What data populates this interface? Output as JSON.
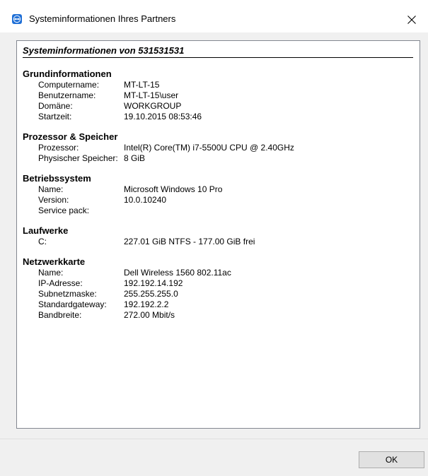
{
  "window": {
    "title": "Systeminformationen Ihres Partners",
    "app_icon": "teamviewer-icon",
    "close_icon": "close-icon"
  },
  "report": {
    "title": "Systeminformationen von 531531531",
    "sections": [
      {
        "heading": "Grundinformationen",
        "rows": [
          {
            "label": "Computername:",
            "value": "MT-LT-15"
          },
          {
            "label": "Benutzername:",
            "value": "MT-LT-15\\user"
          },
          {
            "label": "Domäne:",
            "value": "WORKGROUP"
          },
          {
            "label": "Startzeit:",
            "value": "19.10.2015 08:53:46"
          }
        ]
      },
      {
        "heading": "Prozessor & Speicher",
        "rows": [
          {
            "label": "Prozessor:",
            "value": "Intel(R) Core(TM) i7-5500U CPU @ 2.40GHz"
          },
          {
            "label": "Physischer Speicher:",
            "value": "8 GiB"
          }
        ]
      },
      {
        "heading": "Betriebssystem",
        "rows": [
          {
            "label": "Name:",
            "value": "Microsoft Windows 10 Pro"
          },
          {
            "label": "Version:",
            "value": "10.0.10240"
          },
          {
            "label": "Service pack:",
            "value": ""
          }
        ]
      },
      {
        "heading": "Laufwerke",
        "rows": [
          {
            "label": "C:",
            "value": "227.01 GiB NTFS - 177.00 GiB frei"
          }
        ]
      },
      {
        "heading": "Netzwerkkarte",
        "rows": [
          {
            "label": "Name:",
            "value": "Dell Wireless 1560 802.11ac"
          },
          {
            "label": "IP-Adresse:",
            "value": "192.192.14.192"
          },
          {
            "label": "Subnetzmaske:",
            "value": "255.255.255.0"
          },
          {
            "label": "Standardgateway:",
            "value": "192.192.2.2"
          },
          {
            "label": "Bandbreite:",
            "value": "272.00 Mbit/s"
          }
        ]
      }
    ]
  },
  "buttons": {
    "ok_label": "OK"
  }
}
